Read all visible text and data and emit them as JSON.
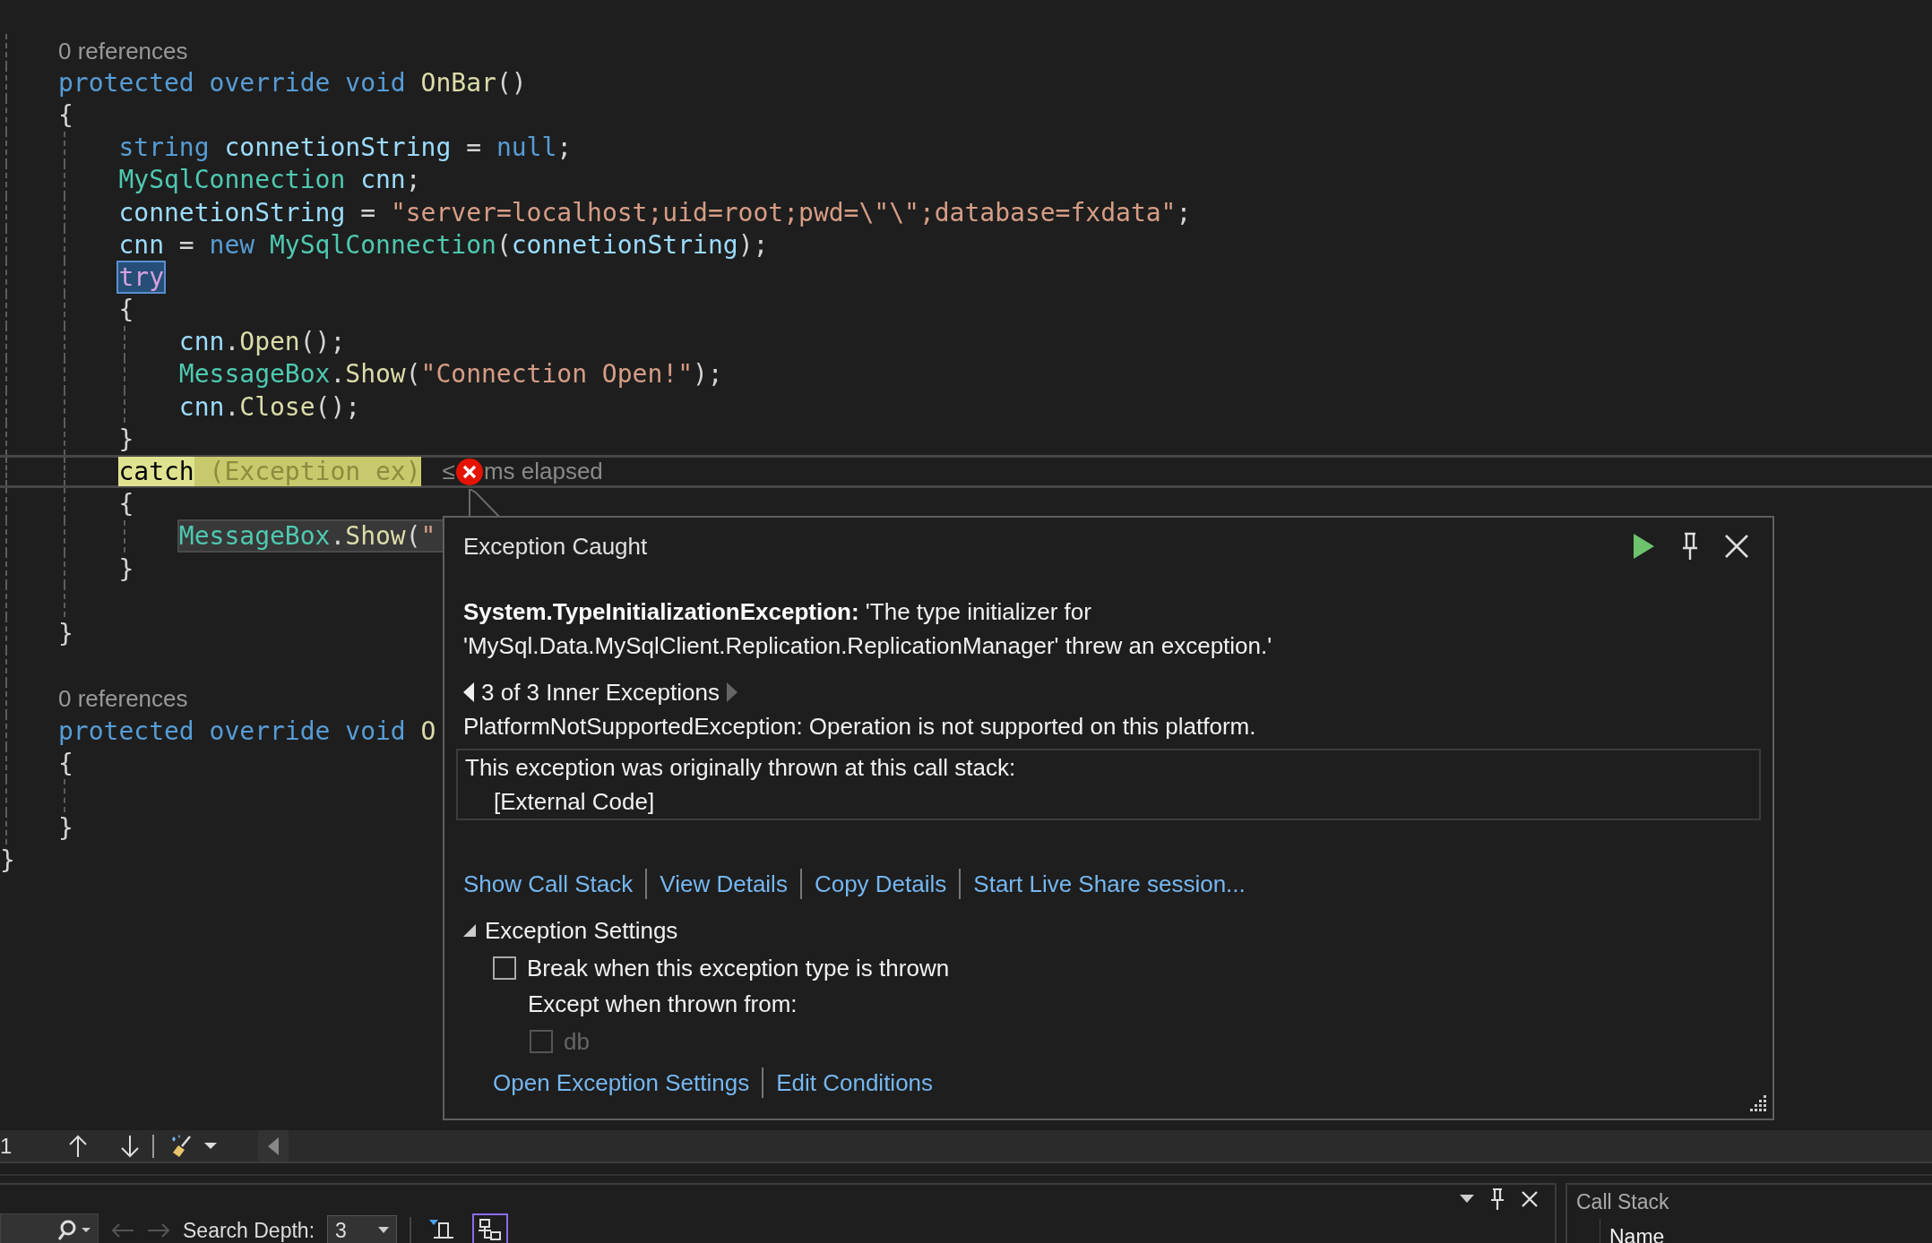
{
  "editor": {
    "lines": [
      {
        "kind": "lens",
        "current": false,
        "tokens": [
          {
            "text": "0 references",
            "kind": "lens"
          }
        ]
      },
      {
        "kind": "code",
        "current": false,
        "tokens": [
          {
            "text": "protected override void ",
            "kind": "keyword"
          },
          {
            "text": "OnBar",
            "kind": "method"
          },
          {
            "text": "()",
            "kind": "punctuation"
          }
        ]
      },
      {
        "kind": "open",
        "current": false,
        "tokens": [
          {
            "text": "{",
            "kind": "punctuation"
          }
        ]
      },
      {
        "kind": "code",
        "current": false,
        "tokens": [
          {
            "text": "string ",
            "kind": "keyword"
          },
          {
            "text": "connetionString",
            "kind": "variable"
          },
          {
            "text": " = ",
            "kind": "punctuation"
          },
          {
            "text": "null",
            "kind": "keyword"
          },
          {
            "text": ";",
            "kind": "punctuation"
          }
        ]
      },
      {
        "kind": "code",
        "current": false,
        "tokens": [
          {
            "text": "MySqlConnection",
            "kind": "type"
          },
          {
            "text": " cnn",
            "kind": "variable"
          },
          {
            "text": ";",
            "kind": "punctuation"
          }
        ]
      },
      {
        "kind": "code",
        "current": false,
        "tokens": [
          {
            "text": "connetionString",
            "kind": "variable"
          },
          {
            "text": " = ",
            "kind": "punctuation"
          },
          {
            "text": "\"server=localhost;uid=root;pwd=\\\"\\\";database=fxdata\"",
            "kind": "string"
          },
          {
            "text": ";",
            "kind": "punctuation"
          }
        ]
      },
      {
        "kind": "code",
        "current": false,
        "tokens": [
          {
            "text": "cnn",
            "kind": "variable"
          },
          {
            "text": " = ",
            "kind": "punctuation"
          },
          {
            "text": "new ",
            "kind": "keyword"
          },
          {
            "text": "MySqlConnection",
            "kind": "type"
          },
          {
            "text": "(",
            "kind": "punctuation"
          },
          {
            "text": "connetionString",
            "kind": "variable"
          },
          {
            "text": ");",
            "kind": "punctuation"
          }
        ]
      },
      {
        "kind": "code",
        "current": false,
        "tokens": [
          {
            "text": "try",
            "kind": "selected-keyword"
          }
        ]
      },
      {
        "kind": "open",
        "current": false,
        "tokens": [
          {
            "text": "{",
            "kind": "punctuation"
          }
        ]
      },
      {
        "kind": "code",
        "current": false,
        "tokens": [
          {
            "text": "cnn",
            "kind": "variable"
          },
          {
            "text": ".",
            "kind": "punctuation"
          },
          {
            "text": "Open",
            "kind": "method"
          },
          {
            "text": "();",
            "kind": "punctuation"
          }
        ]
      },
      {
        "kind": "code",
        "current": false,
        "tokens": [
          {
            "text": "MessageBox",
            "kind": "type"
          },
          {
            "text": ".",
            "kind": "punctuation"
          },
          {
            "text": "Show",
            "kind": "method"
          },
          {
            "text": "(",
            "kind": "punctuation"
          },
          {
            "text": "\"Connection Open!\"",
            "kind": "string"
          },
          {
            "text": ");",
            "kind": "punctuation"
          }
        ]
      },
      {
        "kind": "code",
        "current": false,
        "tokens": [
          {
            "text": "cnn",
            "kind": "variable"
          },
          {
            "text": ".",
            "kind": "punctuation"
          },
          {
            "text": "Close",
            "kind": "method"
          },
          {
            "text": "();",
            "kind": "punctuation"
          }
        ]
      },
      {
        "kind": "close",
        "current": false,
        "tokens": [
          {
            "text": "}",
            "kind": "punctuation"
          }
        ]
      },
      {
        "kind": "code",
        "current": true,
        "tokens": [
          {
            "text": "catch",
            "kind": "statement"
          },
          {
            "text": " (Exception ex)",
            "kind": "statement-rest"
          }
        ],
        "elapsed": {
          "before": "≤",
          "after": "ms elapsed"
        },
        "exception": true
      },
      {
        "kind": "open",
        "current": false,
        "tokens": [
          {
            "text": "{",
            "kind": "punctuation"
          }
        ]
      },
      {
        "kind": "covered",
        "current": false,
        "tokens": [
          {
            "text": "MessageBox",
            "kind": "type"
          },
          {
            "text": ".",
            "kind": "punctuation"
          },
          {
            "text": "Show",
            "kind": "method"
          },
          {
            "text": "(",
            "kind": "punctuation"
          },
          {
            "text": "\"",
            "kind": "string"
          }
        ]
      },
      {
        "kind": "close",
        "current": false,
        "tokens": [
          {
            "text": "}",
            "kind": "punctuation"
          }
        ]
      },
      {
        "kind": "blank",
        "current": false
      },
      {
        "kind": "close",
        "current": false,
        "tokens": [
          {
            "text": "}",
            "kind": "punctuation"
          }
        ]
      },
      {
        "kind": "blank",
        "current": false
      },
      {
        "kind": "lens",
        "current": false,
        "tokens": [
          {
            "text": "0 references",
            "kind": "lens"
          }
        ]
      },
      {
        "kind": "code",
        "current": false,
        "tokens": [
          {
            "text": "protected override void ",
            "kind": "keyword"
          },
          {
            "text": "O",
            "kind": "method"
          }
        ]
      },
      {
        "kind": "open",
        "current": false,
        "tokens": [
          {
            "text": "{",
            "kind": "punctuation"
          }
        ]
      },
      {
        "kind": "blank",
        "current": false
      },
      {
        "kind": "close",
        "current": false,
        "tokens": [
          {
            "text": "}",
            "kind": "punctuation"
          }
        ]
      },
      {
        "kind": "close",
        "current": false,
        "tokens": [
          {
            "text": "}",
            "kind": "punctuation"
          }
        ]
      }
    ]
  },
  "exception_popup": {
    "title": "Exception Caught",
    "message": "**System.TypeInitializationException:** 'The type initializer for 'MySql.Data.MySqlClient.Replication.ReplicationManager' threw an exception.'",
    "inner_nav": {
      "label": "3 of 3 Inner Exceptions",
      "prev_enabled": true,
      "next_enabled": false
    },
    "inner_message": "PlatformNotSupportedException: Operation is not supported on this platform.",
    "call_stack": {
      "heading": "This exception was originally thrown at this call stack:",
      "frames": [
        "[External Code]"
      ]
    },
    "links": [
      "Show Call Stack",
      "View Details",
      "Copy Details",
      "Start Live Share session..."
    ],
    "settings": {
      "label": "Exception Settings",
      "expanded": true,
      "break_option": {
        "label": "Break when this exception type is thrown",
        "checked": false
      },
      "except_label": "Except when thrown from:",
      "modules": [
        {
          "label": "db",
          "checked": false,
          "disabled": true
        }
      ],
      "links": [
        "Open Exception Settings",
        "Edit Conditions"
      ]
    }
  },
  "debug_toolbar": {
    "line_number": "1"
  },
  "output_panel": {
    "search_depth_label": "Search Depth:",
    "search_depth_value": "3",
    "view_buttons": [
      {
        "kind": "filter",
        "selected": false
      },
      {
        "kind": "tree",
        "selected": true
      }
    ]
  },
  "call_stack_panel": {
    "title": "Call Stack",
    "columns": [
      "Name"
    ]
  }
}
